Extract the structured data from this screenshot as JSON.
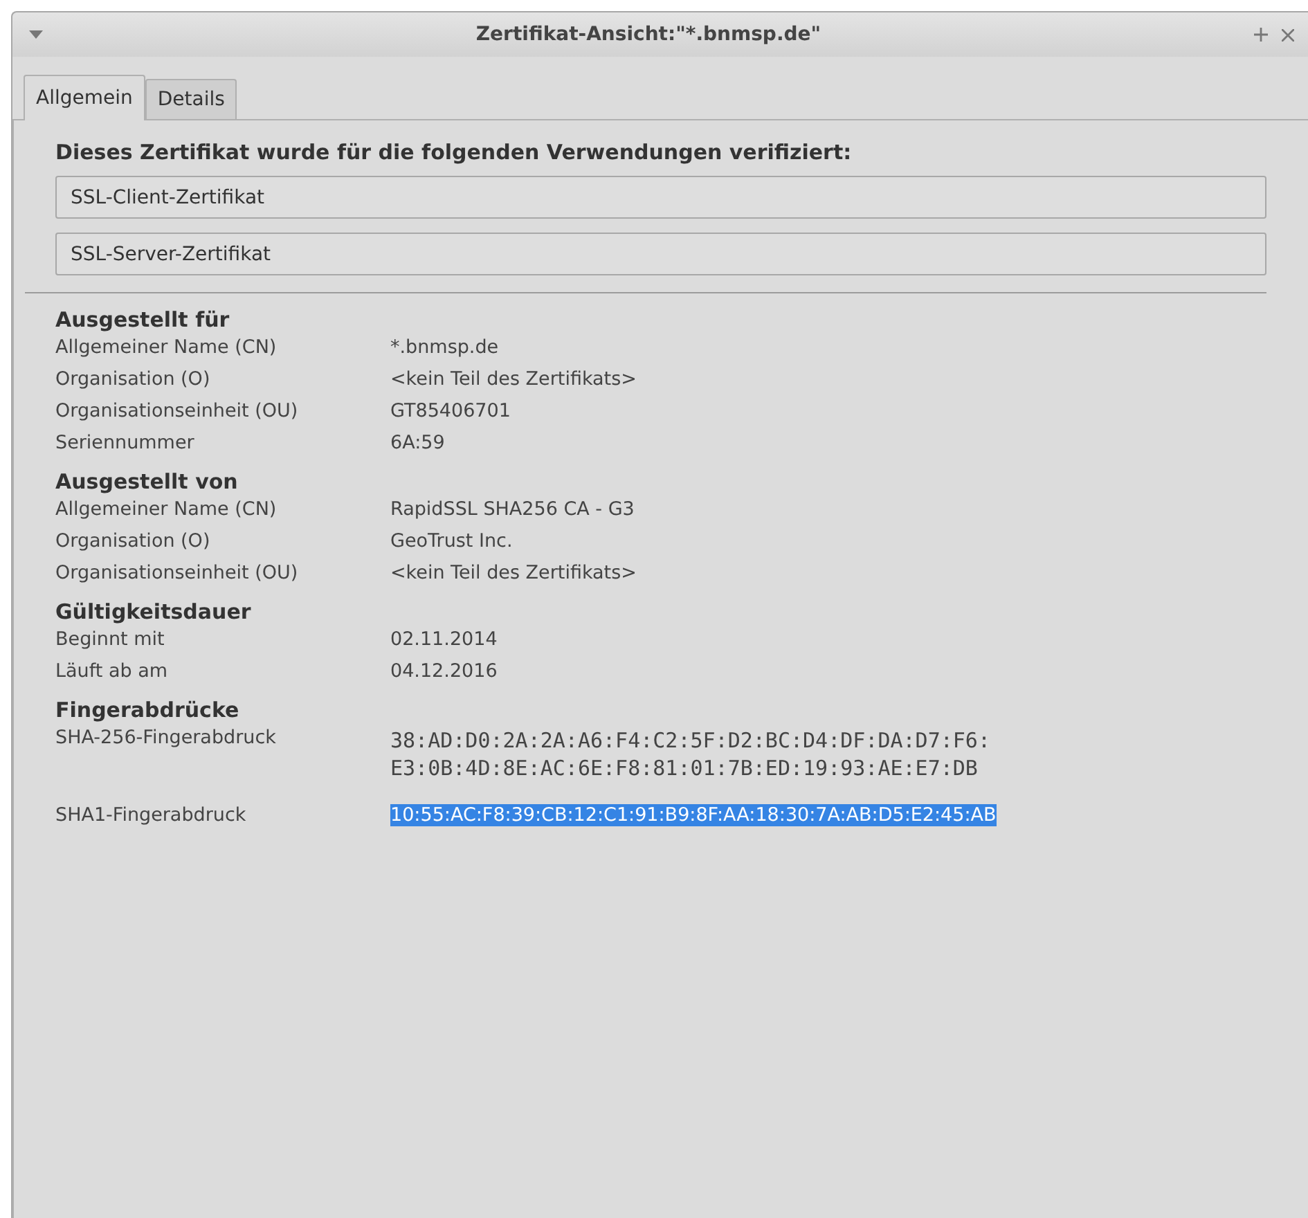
{
  "window": {
    "title": "Zertifikat-Ansicht:\"*.bnmsp.de\""
  },
  "tabs": [
    {
      "label": "Allgemein",
      "selected": true
    },
    {
      "label": "Details",
      "selected": false
    }
  ],
  "verification": {
    "heading": "Dieses Zertifikat wurde für die folgenden Verwendungen verifiziert:",
    "usages": [
      "SSL-Client-Zertifikat",
      "SSL-Server-Zertifikat"
    ]
  },
  "sections": [
    {
      "heading": "Ausgestellt für",
      "rows": [
        {
          "label": "Allgemeiner Name (CN)",
          "value": "*.bnmsp.de"
        },
        {
          "label": "Organisation (O)",
          "value": "<kein Teil des Zertifikats>"
        },
        {
          "label": "Organisationseinheit (OU)",
          "value": "GT85406701"
        },
        {
          "label": "Seriennummer",
          "value": "6A:59"
        }
      ]
    },
    {
      "heading": "Ausgestellt von",
      "rows": [
        {
          "label": "Allgemeiner Name (CN)",
          "value": "RapidSSL SHA256 CA - G3"
        },
        {
          "label": "Organisation (O)",
          "value": "GeoTrust Inc."
        },
        {
          "label": "Organisationseinheit (OU)",
          "value": "<kein Teil des Zertifikats>"
        }
      ]
    },
    {
      "heading": "Gültigkeitsdauer",
      "rows": [
        {
          "label": "Beginnt mit",
          "value": "02.11.2014"
        },
        {
          "label": "Läuft ab am",
          "value": "04.12.2016"
        }
      ]
    },
    {
      "heading": "Fingerabdrücke",
      "rows": [
        {
          "label": "SHA-256-Fingerabdruck",
          "value": "38:AD:D0:2A:2A:A6:F4:C2:5F:D2:BC:D4:DF:DA:D7:F6:E3:0B:4D:8E:AC:6E:F8:81:01:7B:ED:19:93:AE:E7:DB",
          "kind": "mono",
          "selected": false
        },
        {
          "label": "SHA1-Fingerabdruck",
          "value": "10:55:AC:F8:39:CB:12:C1:91:B9:8F:AA:18:30:7A:AB:D5:E2:45:AB",
          "kind": "plain",
          "selected": true
        }
      ]
    }
  ]
}
